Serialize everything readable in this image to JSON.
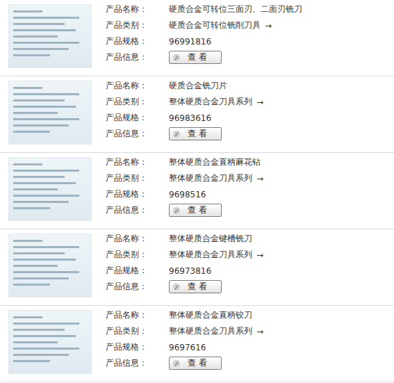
{
  "labels": {
    "name": "产品名称：",
    "category": "产品类别：",
    "spec": "产品规格：",
    "info": "产品信息："
  },
  "products": [
    {
      "name": "硬质合金可转位三面刃、二面刃铣刀",
      "category": "硬质合金可转位铣削刀具",
      "arrow": "→",
      "spec": "96991816",
      "button": "查 看"
    },
    {
      "name": "硬质合金铣刀片",
      "category": "整体硬质合金刀具系列",
      "arrow": "→",
      "spec": "96983616",
      "button": "查 看"
    },
    {
      "name": "整体硬质合金直柄麻花钻",
      "category": "整体硬质合金刀具系列",
      "arrow": "→",
      "spec": "9698516",
      "button": "查 看"
    },
    {
      "name": "整体硬质合金键槽铣刀",
      "category": "整体硬质合金刀具系列",
      "arrow": "→",
      "spec": "96973816",
      "button": "查 看"
    },
    {
      "name": "整体硬质合金直柄铰刀",
      "category": "整体硬质合金刀具系列",
      "arrow": "→",
      "spec": "9697616",
      "button": "查 看"
    }
  ]
}
